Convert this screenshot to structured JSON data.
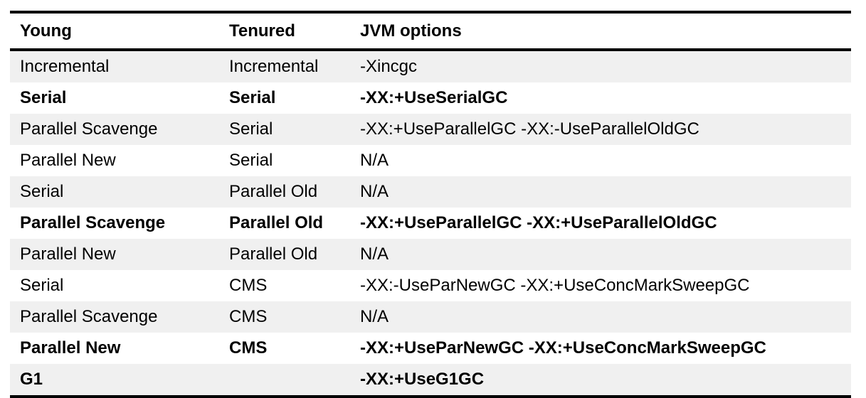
{
  "table": {
    "columns": [
      {
        "key": "young",
        "label": "Young"
      },
      {
        "key": "tenured",
        "label": "Tenured"
      },
      {
        "key": "options",
        "label": "JVM options"
      }
    ],
    "style": {
      "shaded_row_color": "#f0f0f0",
      "plain_row_color": "#ffffff",
      "rule_color": "#000000",
      "text_color": "#000000"
    },
    "rows": [
      {
        "young": "Incremental",
        "tenured": "Incremental",
        "options": "-Xincgc",
        "bold": false,
        "shaded": true
      },
      {
        "young": "Serial",
        "tenured": "Serial",
        "options": "-XX:+UseSerialGC",
        "bold": true,
        "shaded": false
      },
      {
        "young": "Parallel Scavenge",
        "tenured": "Serial",
        "options": "-XX:+UseParallelGC -XX:-UseParallelOldGC",
        "bold": false,
        "shaded": true
      },
      {
        "young": "Parallel New",
        "tenured": "Serial",
        "options": "N/A",
        "bold": false,
        "shaded": false
      },
      {
        "young": "Serial",
        "tenured": "Parallel Old",
        "options": "N/A",
        "bold": false,
        "shaded": true
      },
      {
        "young": "Parallel Scavenge",
        "tenured": "Parallel Old",
        "options": "-XX:+UseParallelGC -XX:+UseParallelOldGC",
        "bold": true,
        "shaded": false
      },
      {
        "young": "Parallel New",
        "tenured": "Parallel Old",
        "options": "N/A",
        "bold": false,
        "shaded": true
      },
      {
        "young": "Serial",
        "tenured": "CMS",
        "options": "-XX:-UseParNewGC -XX:+UseConcMarkSweepGC",
        "bold": false,
        "shaded": false
      },
      {
        "young": "Parallel Scavenge",
        "tenured": "CMS",
        "options": "N/A",
        "bold": false,
        "shaded": true
      },
      {
        "young": "Parallel New",
        "tenured": "CMS",
        "options": "-XX:+UseParNewGC -XX:+UseConcMarkSweepGC",
        "bold": true,
        "shaded": false
      },
      {
        "young": "G1",
        "tenured": "",
        "options": "-XX:+UseG1GC",
        "bold": true,
        "shaded": true
      }
    ]
  }
}
